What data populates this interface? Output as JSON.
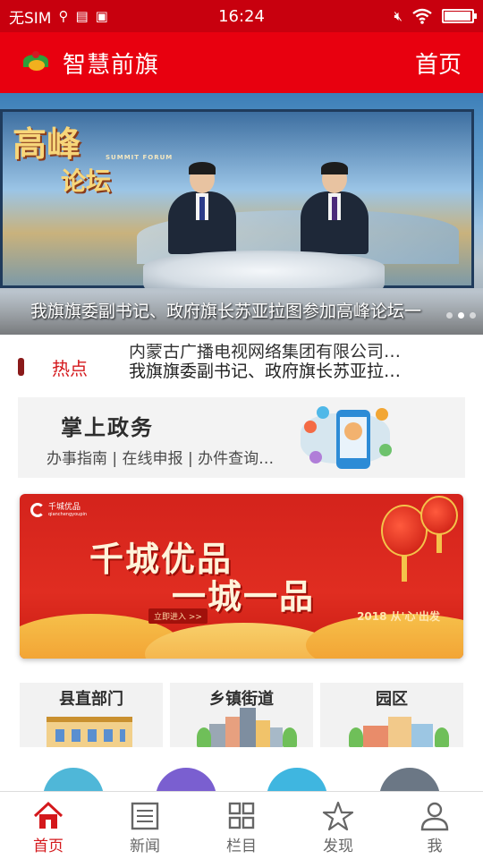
{
  "status_bar": {
    "carrier": "无SIM",
    "time": "16:24",
    "battery_level": 0.9
  },
  "app_bar": {
    "title": "智慧前旗",
    "home_link": "首页"
  },
  "banner": {
    "program_title_line1": "高峰",
    "program_title_line2": "论坛",
    "program_subtitle": "SUMMIT FORUM",
    "caption": "我旗旗委副书记、政府旗长苏亚拉图参加高峰论坛一",
    "dot_count": 3,
    "active_dot": 1
  },
  "hot_news": {
    "label": "热点",
    "previous_item": "内蒙古广播电视网络集团有限公司…",
    "current_item": "我旗旗委副书记、政府旗长苏亚拉…"
  },
  "gov_services": {
    "title": "掌上政务",
    "subtitle": "办事指南 | 在线申报 | 办件查询…"
  },
  "promo": {
    "brand": "千城优品",
    "brand_en": "qianchengyoupin",
    "headline1": "千城优品",
    "headline2": "一城一品",
    "cta": "立即进入 >>",
    "slogan": "2018 从'心'出发"
  },
  "categories": [
    {
      "label": "县直部门"
    },
    {
      "label": "乡镇街道"
    },
    {
      "label": "园区"
    }
  ],
  "shortcut_colors": [
    "#4fb7d8",
    "#7a5fd0",
    "#3fb6e0",
    "#6b7785"
  ],
  "tabs": [
    {
      "label": "首页",
      "icon": "home-icon",
      "active": true
    },
    {
      "label": "新闻",
      "icon": "news-icon",
      "active": false
    },
    {
      "label": "栏目",
      "icon": "grid-icon",
      "active": false
    },
    {
      "label": "发现",
      "icon": "star-icon",
      "active": false
    },
    {
      "label": "我",
      "icon": "user-icon",
      "active": false
    }
  ],
  "colors": {
    "brand_red": "#e8000f",
    "hot_red": "#d4181c"
  }
}
